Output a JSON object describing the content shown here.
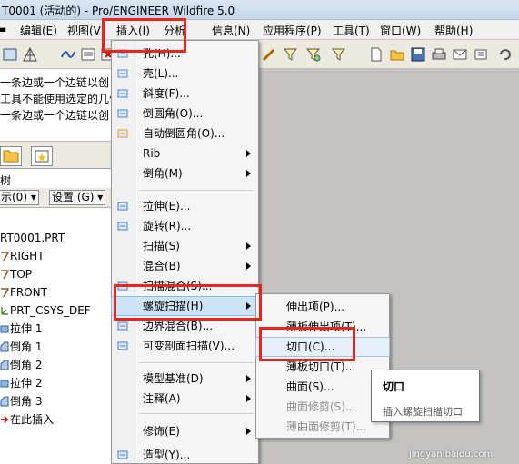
{
  "window": {
    "title": "T0001 (活动的) - Pro/ENGINEER Wildfire 5.0"
  },
  "menubar": {
    "items": [
      "编辑(E)",
      "视图(V",
      "插入(I)",
      "分析",
      "信息(N)",
      "应用程序(P)",
      "工具(T)",
      "窗口(W)",
      "帮助(H)"
    ]
  },
  "messages": [
    "一条边或一个边链以创",
    "工具不能使用选定的几何",
    "一条边或一个边链以创"
  ],
  "left_panel": {
    "short_label": "树",
    "filter_show": "示(0) ▾",
    "filter_settings": "设置 (G) ▾",
    "tree": [
      {
        "label": "RT0001.PRT",
        "icon": "part-icon"
      },
      {
        "label": "RIGHT",
        "icon": "datum-plane-icon"
      },
      {
        "label": "TOP",
        "icon": "datum-plane-icon"
      },
      {
        "label": "FRONT",
        "icon": "datum-plane-icon"
      },
      {
        "label": "PRT_CSYS_DEF",
        "icon": "csys-icon"
      },
      {
        "label": "拉伸 1",
        "icon": "extrude-icon"
      },
      {
        "label": "倒角 1",
        "icon": "chamfer-icon"
      },
      {
        "label": "倒角 2",
        "icon": "chamfer-icon"
      },
      {
        "label": "拉伸 2",
        "icon": "extrude-icon"
      },
      {
        "label": "倒角 3",
        "icon": "chamfer-icon"
      },
      {
        "label": "在此插入",
        "icon": "insert-here-icon"
      }
    ]
  },
  "insert_menu": {
    "items": [
      {
        "label": "孔(H)...",
        "arrow": false,
        "icon": "hole-icon"
      },
      {
        "label": "壳(L)...",
        "arrow": false,
        "icon": "shell-icon"
      },
      {
        "label": "斜度(F)...",
        "arrow": false,
        "icon": "draft-icon"
      },
      {
        "label": "倒圆角(O)...",
        "arrow": false,
        "icon": "round-icon"
      },
      {
        "label": "自动倒圆角(O)...",
        "arrow": false,
        "icon": "auto-round-icon"
      },
      {
        "label": "Rib",
        "arrow": true,
        "icon": ""
      },
      {
        "label": "倒角(M)",
        "arrow": true,
        "icon": ""
      },
      {
        "label": "拉伸(E)...",
        "arrow": false,
        "icon": "extrude-icon"
      },
      {
        "label": "旋转(R)...",
        "arrow": false,
        "icon": "revolve-icon"
      },
      {
        "label": "扫描(S)",
        "arrow": true,
        "icon": ""
      },
      {
        "label": "混合(B)",
        "arrow": true,
        "icon": ""
      },
      {
        "label": "扫描混合(S)...",
        "arrow": false,
        "icon": "swept-blend-icon"
      },
      {
        "label": "螺旋扫描(H)",
        "arrow": true,
        "icon": "",
        "highlight": true
      },
      {
        "label": "边界混合(B)...",
        "arrow": false,
        "icon": "boundary-blend-icon"
      },
      {
        "label": "可变剖面扫描(V)...",
        "arrow": false,
        "icon": "var-sweep-icon"
      },
      {
        "label": "模型基准(D)",
        "arrow": true,
        "icon": ""
      },
      {
        "label": "注释(A)",
        "arrow": true,
        "icon": ""
      },
      {
        "label": "修饰(E)",
        "arrow": true,
        "icon": ""
      },
      {
        "label": "造型(Y)...",
        "arrow": false,
        "icon": "style-icon"
      }
    ]
  },
  "helical_submenu": {
    "items": [
      {
        "label": "伸出项(P)...",
        "disabled": false
      },
      {
        "label": "薄板伸出项(T)...",
        "disabled": false
      },
      {
        "label": "切口(C)...",
        "disabled": false,
        "hover": true
      },
      {
        "label": "薄板切口(T)...",
        "disabled": false
      },
      {
        "label": "曲面(S)...",
        "disabled": false
      },
      {
        "label": "曲面修剪(S)...",
        "disabled": true
      },
      {
        "label": "薄曲面修剪(T)...",
        "disabled": true
      }
    ]
  },
  "tooltip": {
    "title": "切口",
    "description": "插入螺旋扫描切口"
  },
  "watermark": "jingyan.baidu.com",
  "colors": {
    "annotation": "#e8261f",
    "highlight": "#cde4f7",
    "graphics_bg": "#c3c2c0"
  }
}
